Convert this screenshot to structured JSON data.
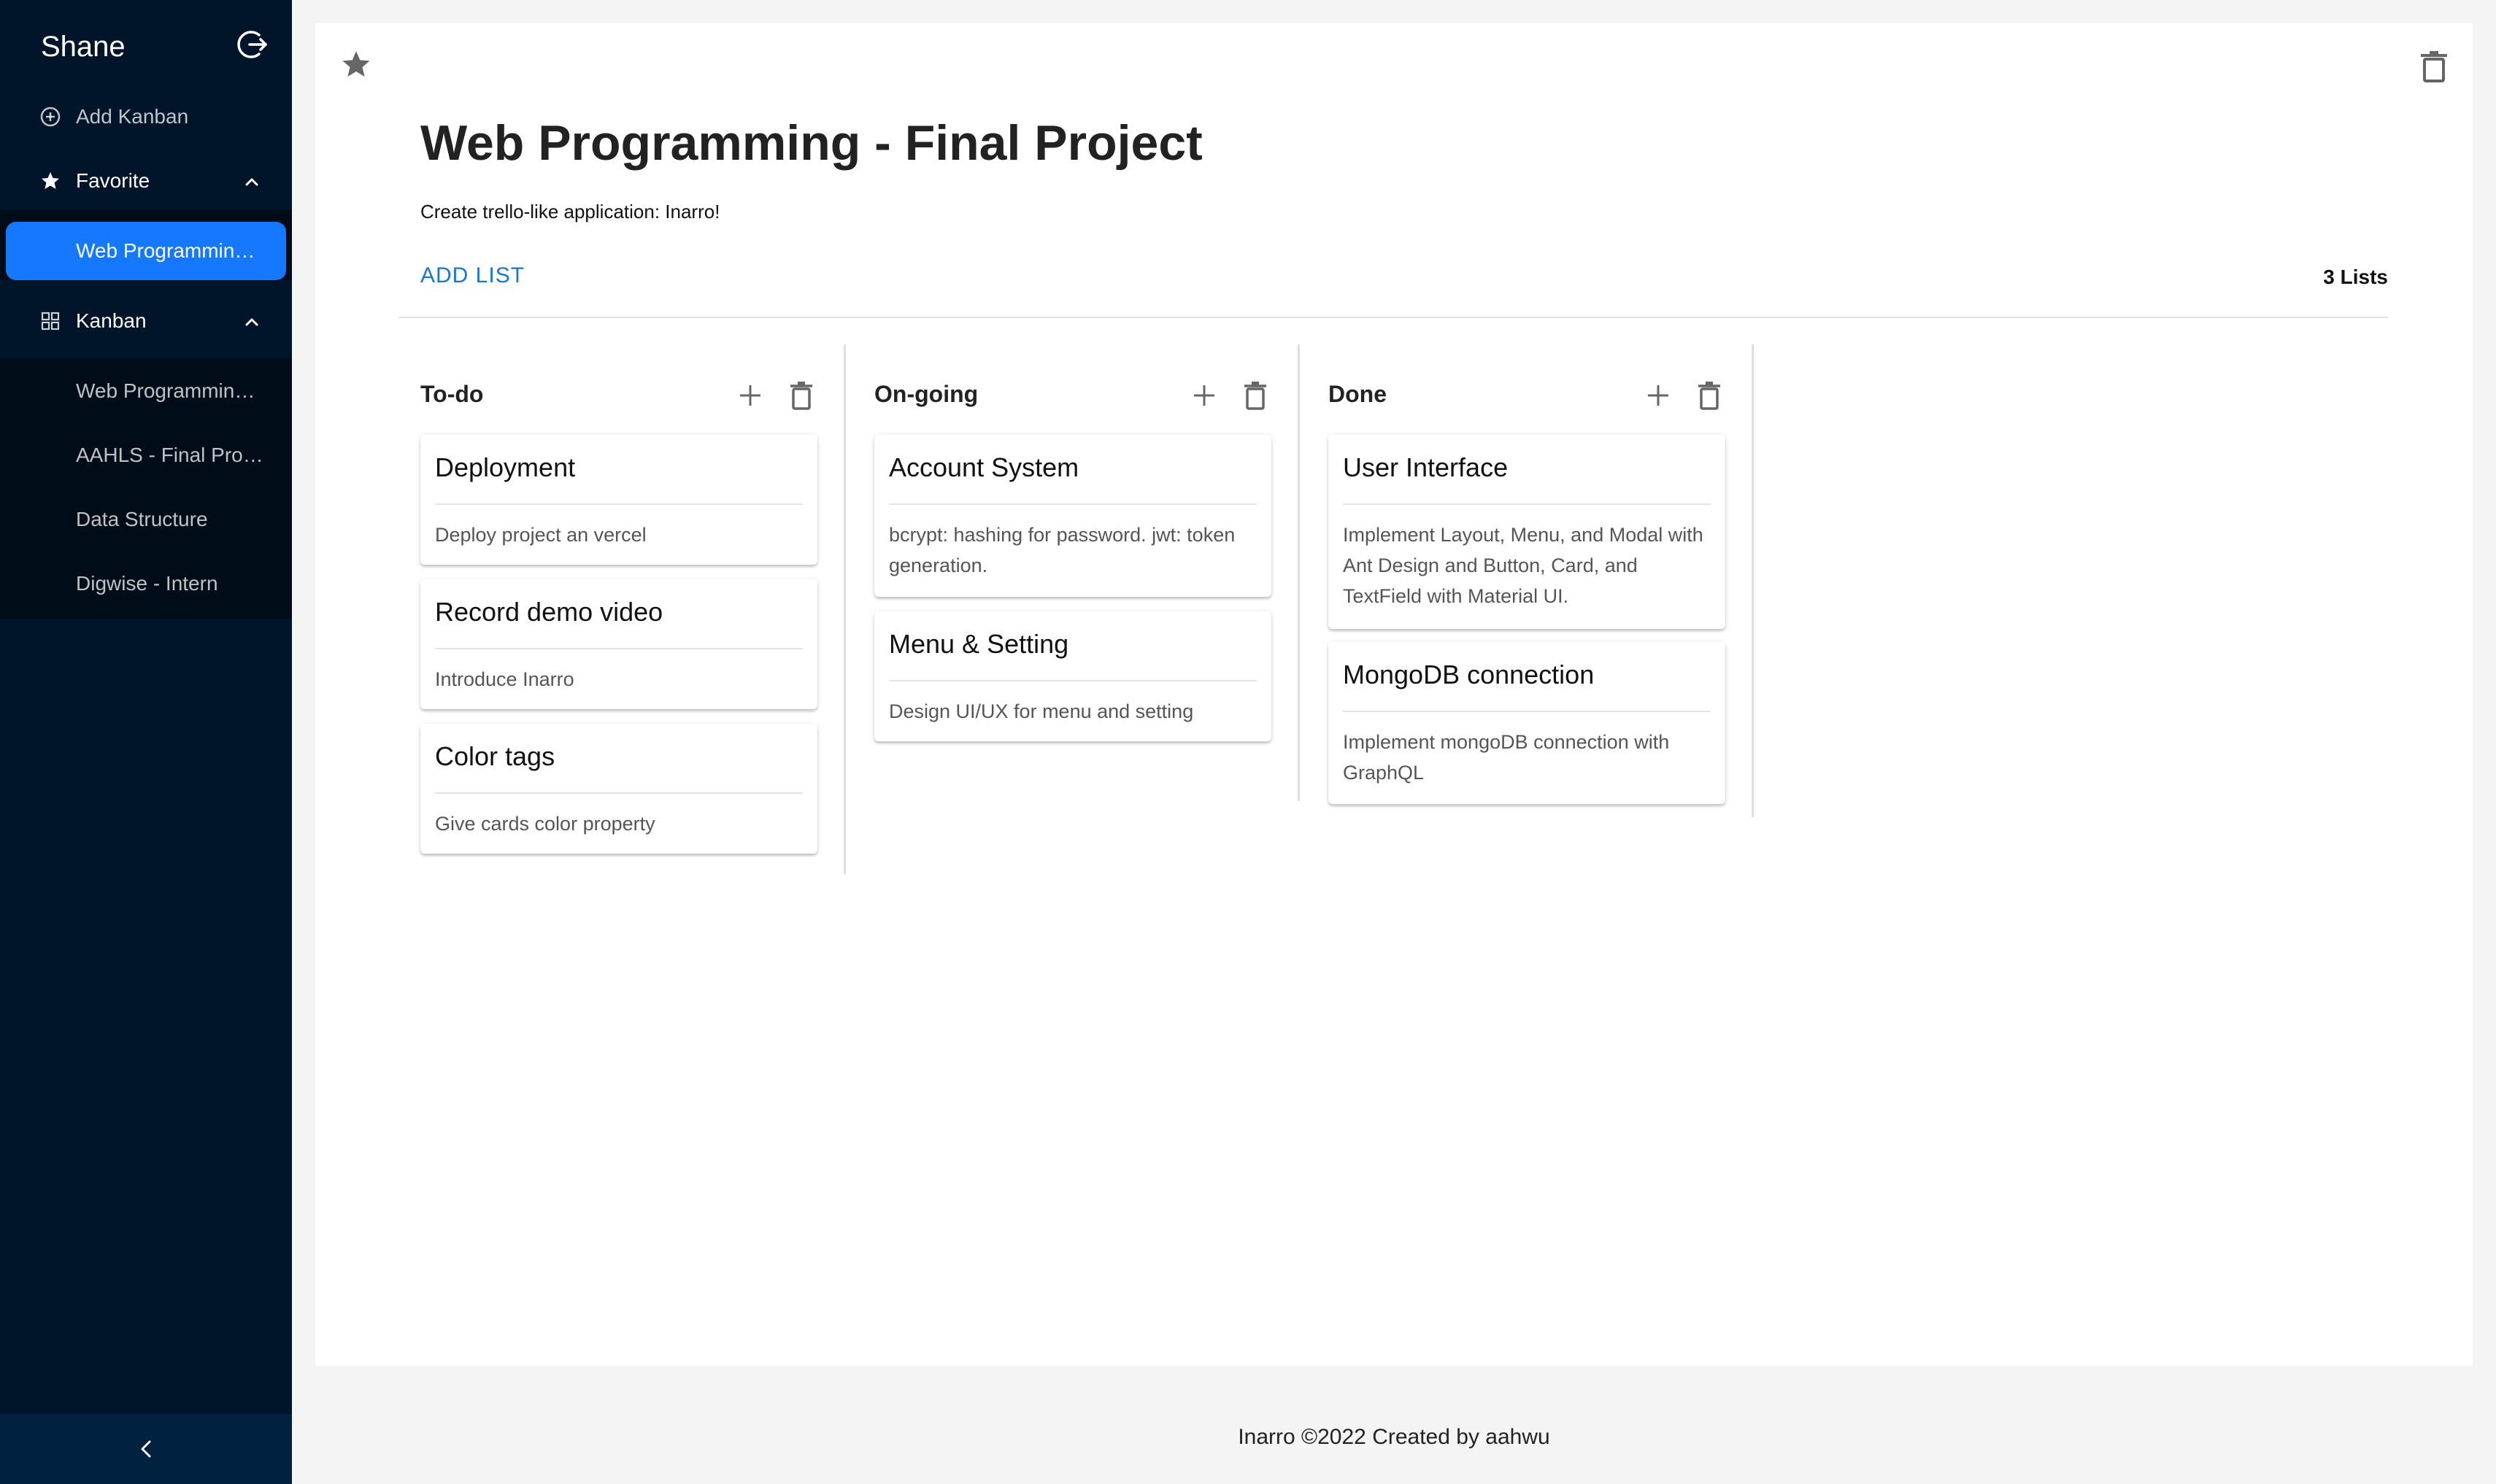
{
  "sidebar": {
    "user_name": "Shane",
    "add_kanban_label": "Add Kanban",
    "favorite_label": "Favorite",
    "favorite_items": [
      "Web Programming - Final Project"
    ],
    "kanban_label": "Kanban",
    "kanban_items": [
      "Web Programming - Final Project",
      "AAHLS - Final Project",
      "Data Structure",
      "Digwise - Intern"
    ]
  },
  "board": {
    "title": "Web Programming - Final Project",
    "description": "Create trello-like application: Inarro!",
    "add_list_label": "ADD LIST",
    "list_count": "3 Lists"
  },
  "lists": [
    {
      "title": "To-do",
      "cards": [
        {
          "title": "Deployment",
          "description": "Deploy project an vercel"
        },
        {
          "title": "Record demo video",
          "description": "Introduce Inarro"
        },
        {
          "title": "Color tags",
          "description": "Give cards color property"
        }
      ]
    },
    {
      "title": "On-going",
      "cards": [
        {
          "title": "Account System",
          "description": "bcrypt: hashing for password. jwt: token generation."
        },
        {
          "title": "Menu & Setting",
          "description": "Design UI/UX for menu and setting"
        }
      ]
    },
    {
      "title": "Done",
      "cards": [
        {
          "title": "User Interface",
          "description": "Implement Layout, Menu, and Modal with Ant Design and Button, Card, and TextField with Material UI."
        },
        {
          "title": "MongoDB connection",
          "description": "Implement mongoDB connection with GraphQL"
        }
      ]
    }
  ],
  "footer": {
    "text": "Inarro ©2022 Created by aahwu"
  },
  "icons": {
    "logout": "logout-icon",
    "add_kanban": "plus-circle-icon",
    "favorite": "star-icon",
    "kanban": "grid-icon",
    "expand": "chevron-up-icon",
    "star_board": "star-icon",
    "delete": "trash-icon",
    "add_card": "plus-icon",
    "collapse_sidebar": "chevron-left-icon"
  },
  "colors": {
    "sidebar_bg": "#001529",
    "submenu_bg": "#000c17",
    "selected_bg": "#1677ff",
    "accent_link": "#1976d2",
    "page_bg": "#f4f4f4"
  }
}
